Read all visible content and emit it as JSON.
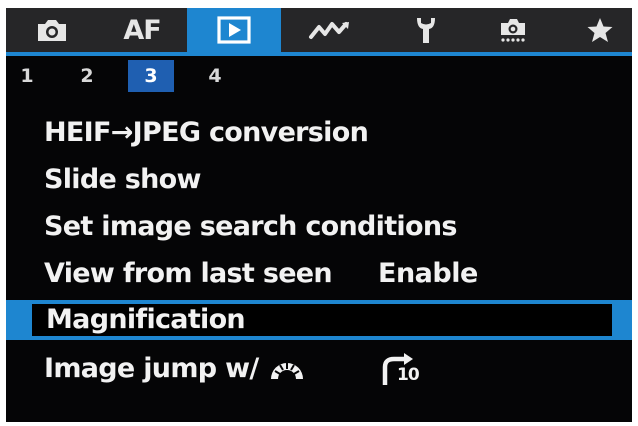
{
  "tabs": [
    {
      "id": "shooting",
      "icon": "camera-icon",
      "active": false
    },
    {
      "id": "af",
      "label": "AF",
      "active": false
    },
    {
      "id": "playback",
      "icon": "play-icon",
      "active": true
    },
    {
      "id": "wireless",
      "icon": "wireless-icon",
      "active": false
    },
    {
      "id": "setup",
      "icon": "wrench-icon",
      "active": false
    },
    {
      "id": "custom",
      "icon": "custom-camera-icon",
      "active": false
    },
    {
      "id": "mymenu",
      "icon": "star-icon",
      "active": false
    }
  ],
  "subtabs": [
    "1",
    "2",
    "3",
    "4"
  ],
  "active_subtab": "3",
  "menu": [
    {
      "label": "HEIF→JPEG conversion",
      "value": ""
    },
    {
      "label": "Slide show",
      "value": ""
    },
    {
      "label": "Set image search conditions",
      "value": ""
    },
    {
      "label": "View from last seen",
      "value": "Enable"
    },
    {
      "label": "Magnification",
      "value": "",
      "selected": true
    },
    {
      "label": "Image jump w/",
      "icon": "main-dial-icon",
      "value_icon": "jump-10-icon",
      "value_icon_text": "10"
    }
  ],
  "colors": {
    "accent": "#1e86d0",
    "subtab_active": "#1f5fb1",
    "background": "#050506",
    "tabbar": "#262628",
    "text": "#f2f2f2"
  }
}
